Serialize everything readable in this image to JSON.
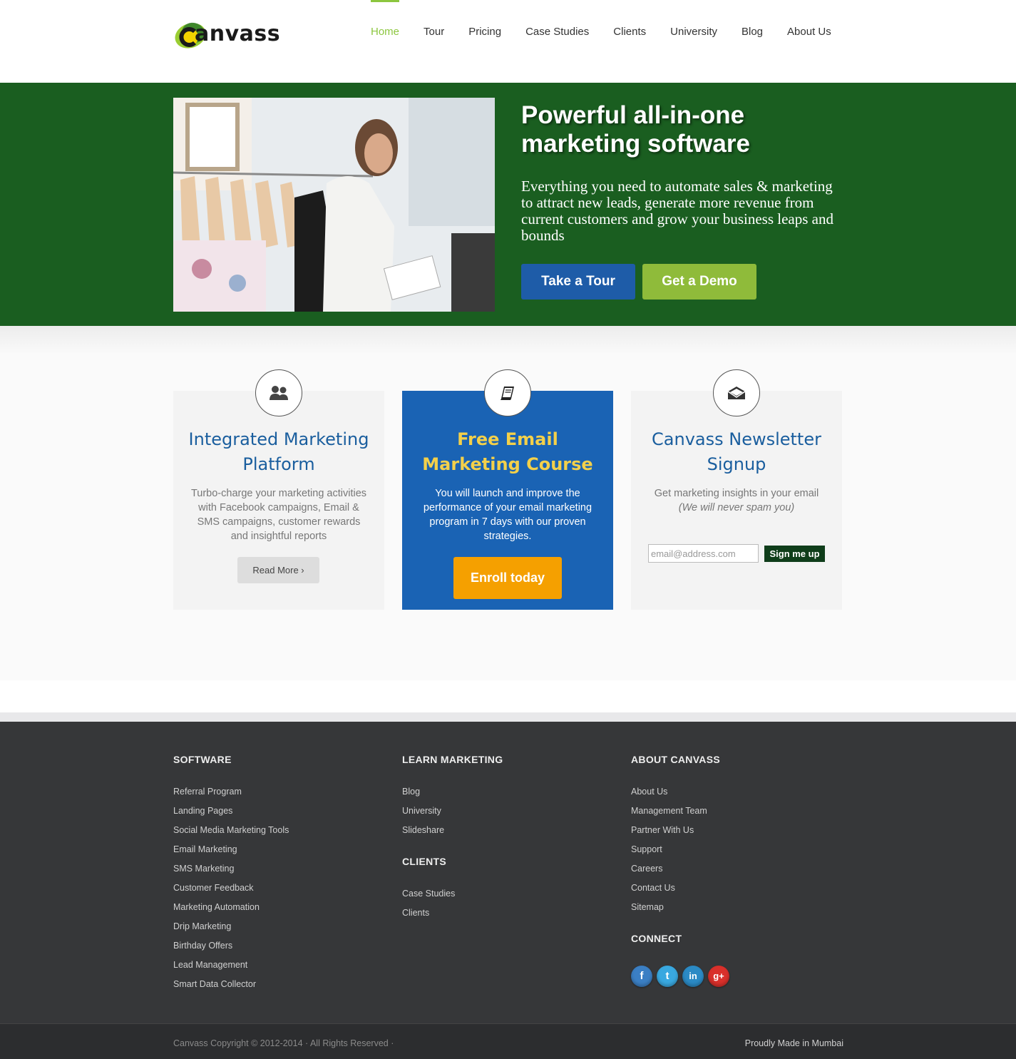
{
  "brand": {
    "logo_text": "anvass",
    "logo_initial": "C",
    "accent": "#8cc63f"
  },
  "nav": {
    "items": [
      {
        "label": "Home",
        "active": true
      },
      {
        "label": "Tour"
      },
      {
        "label": "Pricing"
      },
      {
        "label": "Case Studies"
      },
      {
        "label": "Clients"
      },
      {
        "label": "University"
      },
      {
        "label": "Blog"
      },
      {
        "label": "About Us"
      }
    ]
  },
  "hero": {
    "title": "Powerful all-in-one marketing software",
    "subtitle": "Everything you need to automate sales & marketing to attract new leads, generate more revenue from current customers and grow your business leaps and bounds",
    "tour_button": "Take a Tour",
    "demo_button": "Get a Demo",
    "background": "#1a5e20"
  },
  "features": {
    "cards": [
      {
        "icon": "users-icon",
        "title": "Integrated Marketing Platform",
        "text": "Turbo-charge your marketing activities with Facebook campaigns, Email & SMS campaigns, customer rewards and insightful reports",
        "button": "Read More ›"
      },
      {
        "icon": "book-icon",
        "title": "Free Email Marketing Course",
        "text": "You will launch and improve the performance of your email marketing program in 7 days with our proven strategies.",
        "button": "Enroll today"
      },
      {
        "icon": "envelope-icon",
        "title": "Canvass Newsletter Signup",
        "text": "Get marketing insights in your email",
        "note": "(We will never spam you)",
        "input_placeholder": "email@address.com",
        "button": "Sign me up"
      }
    ]
  },
  "footer": {
    "software": {
      "heading": "SOFTWARE",
      "links": [
        "Referral Program",
        "Landing Pages",
        "Social Media Marketing Tools",
        "Email Marketing",
        "SMS Marketing",
        "Customer Feedback",
        "Marketing Automation",
        "Drip Marketing",
        "Birthday Offers",
        "Lead Management",
        "Smart Data Collector"
      ]
    },
    "learn": {
      "heading": "LEARN MARKETING",
      "links": [
        "Blog",
        "University",
        "Slideshare"
      ]
    },
    "clients": {
      "heading": "CLIENTS",
      "links": [
        "Case Studies",
        "Clients"
      ]
    },
    "about": {
      "heading": "ABOUT CANVASS",
      "links": [
        "About Us",
        "Management Team",
        "Partner With Us",
        "Support",
        "Careers",
        "Contact Us",
        "Sitemap"
      ]
    },
    "connect": {
      "heading": "CONNECT",
      "icons": [
        {
          "name": "facebook-icon",
          "glyph": "f"
        },
        {
          "name": "twitter-icon",
          "glyph": "t"
        },
        {
          "name": "linkedin-icon",
          "glyph": "in"
        },
        {
          "name": "google-plus-icon",
          "glyph": "g+"
        }
      ]
    },
    "copyright": "Canvass Copyright © 2012-2014 · All Rights Reserved ·",
    "made_in": "Proudly Made in Mumbai"
  }
}
